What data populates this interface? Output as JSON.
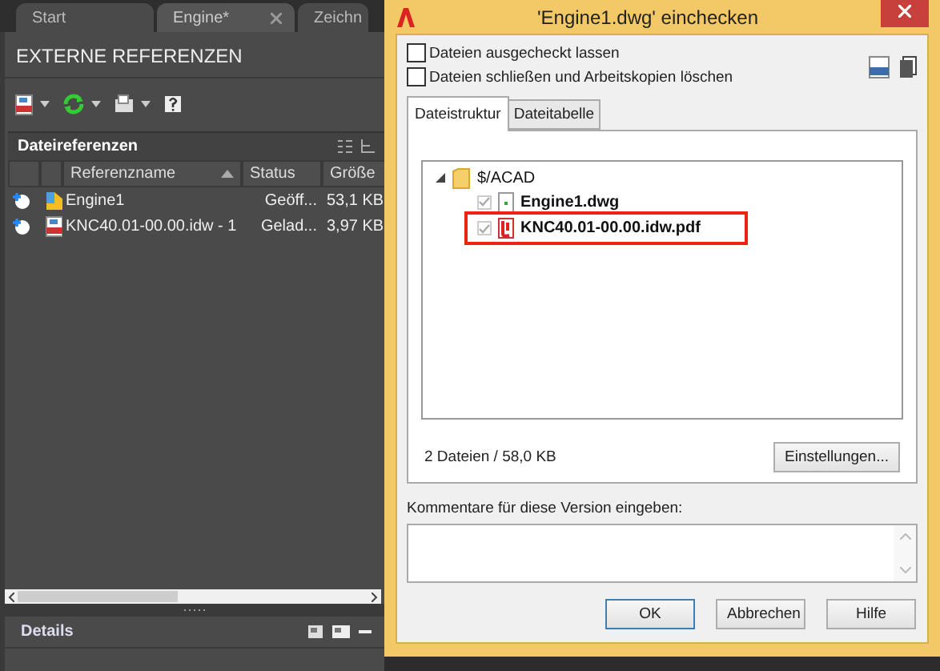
{
  "doc_tabs": [
    {
      "label": "Start",
      "selected": false,
      "closable": false
    },
    {
      "label": "Engine*",
      "selected": true,
      "closable": true
    },
    {
      "label": "Zeichn",
      "selected": false,
      "closable": false
    }
  ],
  "palette": {
    "title": "EXTERNE REFERENZEN",
    "section": "Dateireferenzen",
    "columns": [
      {
        "sorted": false
      },
      {
        "sorted": false
      },
      {
        "label": "Referenzname",
        "sorted": true
      },
      {
        "label": "Status",
        "sorted": false
      },
      {
        "label": "Größe",
        "sorted": false
      }
    ],
    "rows": [
      {
        "kind": "dwg",
        "name": "Engine1",
        "status": "Geöff...",
        "size": "53,1 KB"
      },
      {
        "kind": "pdf",
        "name": "KNC40.01-00.00.idw - 1",
        "status": "Gelad...",
        "size": "3,97 KB"
      }
    ],
    "details": "Details"
  },
  "dialog": {
    "title": "'Engine1.dwg' einchecken",
    "options": [
      {
        "label": "Dateien ausgecheckt lassen",
        "checked": false
      },
      {
        "label": "Dateien schließen und Arbeitskopien löschen",
        "checked": false
      }
    ],
    "tabs": [
      {
        "label": "Dateistruktur",
        "selected": true
      },
      {
        "label": "Dateitabelle",
        "selected": false
      }
    ],
    "tree": {
      "label": "$/ACAD",
      "expanded": true,
      "children": [
        {
          "kind": "dwg",
          "label": "Engine1.dwg",
          "checked": true,
          "highlighted": false
        },
        {
          "kind": "pdf",
          "label": "KNC40.01-00.00.idw.pdf",
          "checked": true,
          "highlighted": true
        }
      ]
    },
    "summary": "2 Dateien / 58,0 KB",
    "settings_button": "Einstellungen...",
    "comment_label": "Kommentare für diese Version eingeben:",
    "buttons": [
      {
        "label": "OK",
        "default": true
      },
      {
        "label": "Abbrechen",
        "default": false
      },
      {
        "label": "Hilfe",
        "default": false
      }
    ]
  }
}
